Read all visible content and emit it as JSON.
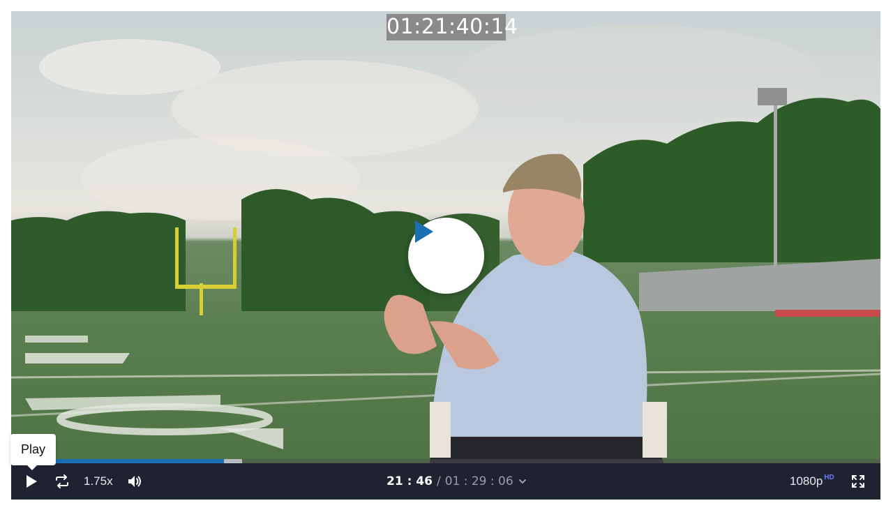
{
  "player": {
    "timecode_overlay": "01:21:40:14",
    "progress_played_fraction": 0.245,
    "progress_buffered_fraction": 0.266,
    "tooltip": "Play",
    "controls": {
      "speed": "1.75x",
      "time_current": "21 : 46",
      "time_separator": "/",
      "time_total": "01 : 29 : 06",
      "quality": "1080p",
      "quality_badge": "HD"
    },
    "icons": [
      "play-icon",
      "big-play-icon",
      "loop-icon",
      "volume-icon",
      "chevron-down-icon",
      "fullscreen-icon"
    ]
  },
  "colors": {
    "accent": "#1a6fb3",
    "controls_bg": "#1f2230",
    "hd_badge": "#6f7cff"
  }
}
